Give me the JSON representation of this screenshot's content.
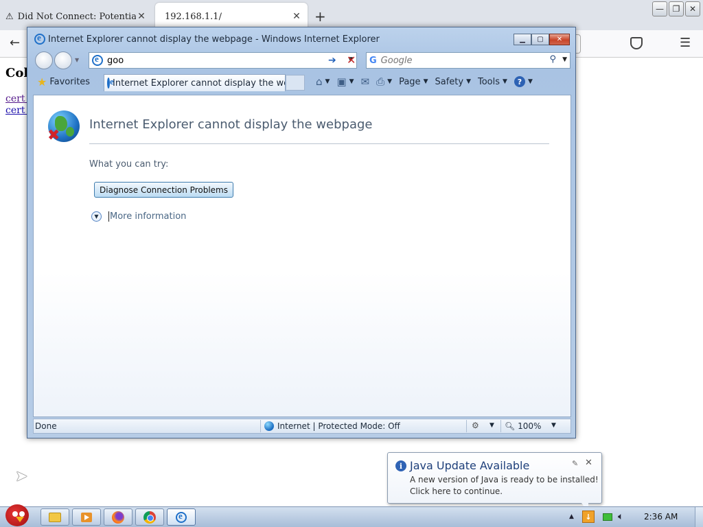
{
  "firefox": {
    "tabs": [
      {
        "label": "Did Not Connect: Potential S",
        "icon": "warning-icon",
        "close": "✕"
      },
      {
        "label": "192.168.1.1/",
        "close": "✕"
      }
    ],
    "new_tab": "+",
    "page": {
      "heading": "Coll",
      "links": [
        "cert c",
        "cert c"
      ]
    }
  },
  "ie": {
    "window_title": "Internet Explorer cannot display the webpage - Windows Internet Explorer",
    "address_value": "goo",
    "search_placeholder": "Google",
    "favorites_label": "Favorites",
    "tab_label": "Internet Explorer cannot display the we...",
    "command_bar": {
      "page": "Page",
      "safety": "Safety",
      "tools": "Tools"
    },
    "content": {
      "title": "Internet Explorer cannot display the webpage",
      "try_text": "What you can try:",
      "diagnose_button": "Diagnose Connection Problems",
      "more_info": "More information"
    },
    "status": {
      "text": "Done",
      "zone": "Internet | Protected Mode: Off",
      "zoom": "100%"
    }
  },
  "notification": {
    "title": "Java Update Available",
    "line1": "A new version of Java is ready to be installed!",
    "line2": "Click here to continue."
  },
  "taskbar": {
    "clock": "2:36 AM",
    "pinned": [
      "explorer-icon",
      "media-player-icon",
      "firefox-icon",
      "chrome-icon",
      "internet-explorer-icon"
    ]
  },
  "colors": {
    "ie_frame": "#a9c3e3",
    "error_title": "#4a5b6f",
    "balloon_title": "#1e3f7a",
    "link": "#1a0dab"
  }
}
